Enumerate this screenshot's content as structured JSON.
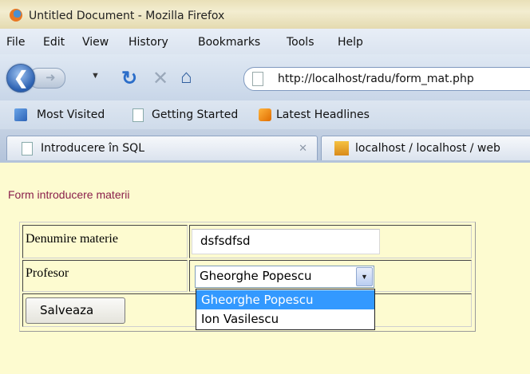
{
  "window": {
    "title": "Untitled Document - Mozilla Firefox"
  },
  "menu": {
    "items": [
      "File",
      "Edit",
      "View",
      "History",
      "Bookmarks",
      "Tools",
      "Help"
    ]
  },
  "nav": {
    "url": "http://localhost/radu/form_mat.php"
  },
  "bookmarks": {
    "items": [
      "Most Visited",
      "Getting Started",
      "Latest Headlines"
    ]
  },
  "tabs": [
    {
      "label": "Introducere în SQL",
      "icon": "page-icon"
    },
    {
      "label": "localhost / localhost / web",
      "icon": "phpmyadmin-icon"
    }
  ],
  "page": {
    "heading": "Form introducere materii",
    "row1_label": "Denumire materie",
    "row1_value": "dsfsdfsd",
    "row2_label": "Profesor",
    "select_value": "Gheorghe Popescu",
    "options": [
      "Gheorghe Popescu",
      "Ion Vasilescu"
    ],
    "save_label": "Salveaza"
  },
  "colors": {
    "page_bg": "#fdfbd0",
    "heading": "#8a1f4b",
    "selected_option": "#3399ff"
  }
}
